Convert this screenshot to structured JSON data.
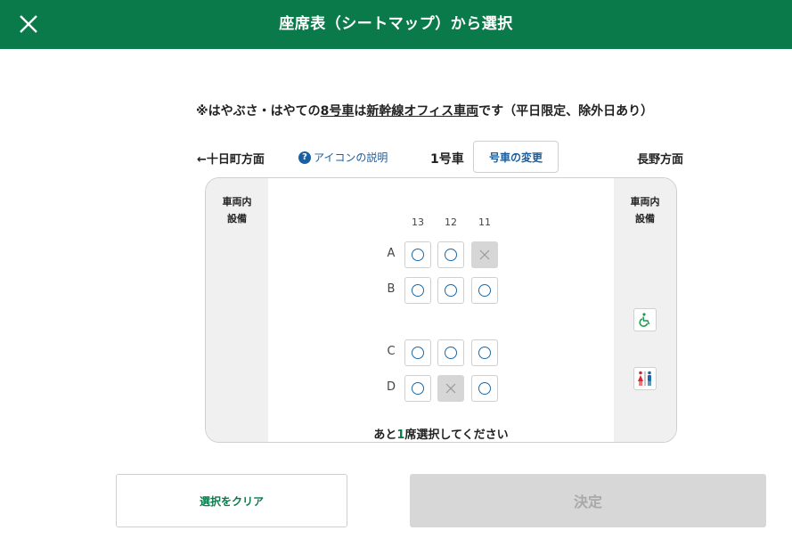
{
  "header": {
    "title": "座席表（シートマップ）から選択",
    "close_icon": "close-icon"
  },
  "notice": {
    "prefix": "※はやぶさ・はやての",
    "car_link": "8号車",
    "middle": "は",
    "office_link": "新幹線オフィス車両",
    "suffix": "です（平日限定、除外日あり）"
  },
  "direction": {
    "left": "←十日町方面",
    "right": "長野方面"
  },
  "icon_help": {
    "label": "アイコンの説明",
    "icon": "question-circle-icon"
  },
  "car": {
    "label": "1号車",
    "change_button": "号車の変更"
  },
  "seatmap": {
    "side_left_label": "車両内\n設備",
    "side_right_label": "車両内\n設備",
    "columns": [
      "13",
      "12",
      "11"
    ],
    "rows": [
      {
        "label": "A",
        "seats": [
          {
            "col": "13",
            "status": "available"
          },
          {
            "col": "12",
            "status": "available"
          },
          {
            "col": "11",
            "status": "taken"
          }
        ]
      },
      {
        "label": "B",
        "seats": [
          {
            "col": "13",
            "status": "available"
          },
          {
            "col": "12",
            "status": "available"
          },
          {
            "col": "11",
            "status": "available"
          }
        ]
      },
      {
        "label": "C",
        "seats": [
          {
            "col": "13",
            "status": "available"
          },
          {
            "col": "12",
            "status": "available"
          },
          {
            "col": "11",
            "status": "available"
          }
        ]
      },
      {
        "label": "D",
        "seats": [
          {
            "col": "13",
            "status": "available"
          },
          {
            "col": "12",
            "status": "taken"
          },
          {
            "col": "11",
            "status": "available"
          }
        ]
      }
    ],
    "facilities": [
      {
        "icon": "wheelchair-icon"
      },
      {
        "icon": "restroom-icon"
      }
    ],
    "remaining": {
      "prefix": "あと",
      "count": "1",
      "suffix": "席選択してください"
    }
  },
  "buttons": {
    "clear": "選択をクリア",
    "decide": "決定"
  },
  "colors": {
    "brand_green": "#0a7a4a",
    "link_blue": "#1a5fa0",
    "seat_mark": "#1a6aa8",
    "taken_gray": "#d6d6d6",
    "disabled_button": "#d7d7d7"
  }
}
